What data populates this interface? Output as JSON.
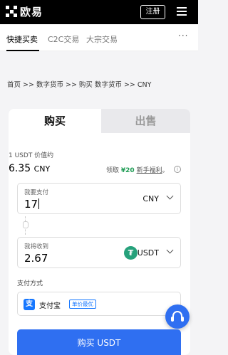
{
  "header": {
    "brand": "欧易",
    "register_label": "注册"
  },
  "tabs": [
    {
      "label": "快捷买卖",
      "active": true
    },
    {
      "label": "C2C交易",
      "active": false
    },
    {
      "label": "大宗交易",
      "active": false
    }
  ],
  "more_label": "···",
  "breadcrumb": "首页 >> 数字货币 >> 购买 数字货币 >> CNY",
  "trade": {
    "buy_tab": "购买",
    "sell_tab": "出售",
    "rate_label": "1 USDT 价值约",
    "rate_value": "6.35",
    "rate_currency": "CNY",
    "promo_prefix": "领取",
    "promo_amount": "¥20",
    "promo_link": "新手福利",
    "promo_suffix": "。",
    "info_icon": "i",
    "pay_label": "我要支付",
    "pay_value": "17",
    "pay_currency": "CNY",
    "receive_label": "我将收到",
    "receive_value": "2.67",
    "receive_currency": "USDT",
    "method_label": "支付方式",
    "method_name": "支付宝",
    "method_badge": "单价最优",
    "buy_button": "购买 USDT"
  },
  "colors": {
    "accent": "#2f6ff1",
    "promo_green": "#1f9c55",
    "tether": "#26a17b"
  }
}
